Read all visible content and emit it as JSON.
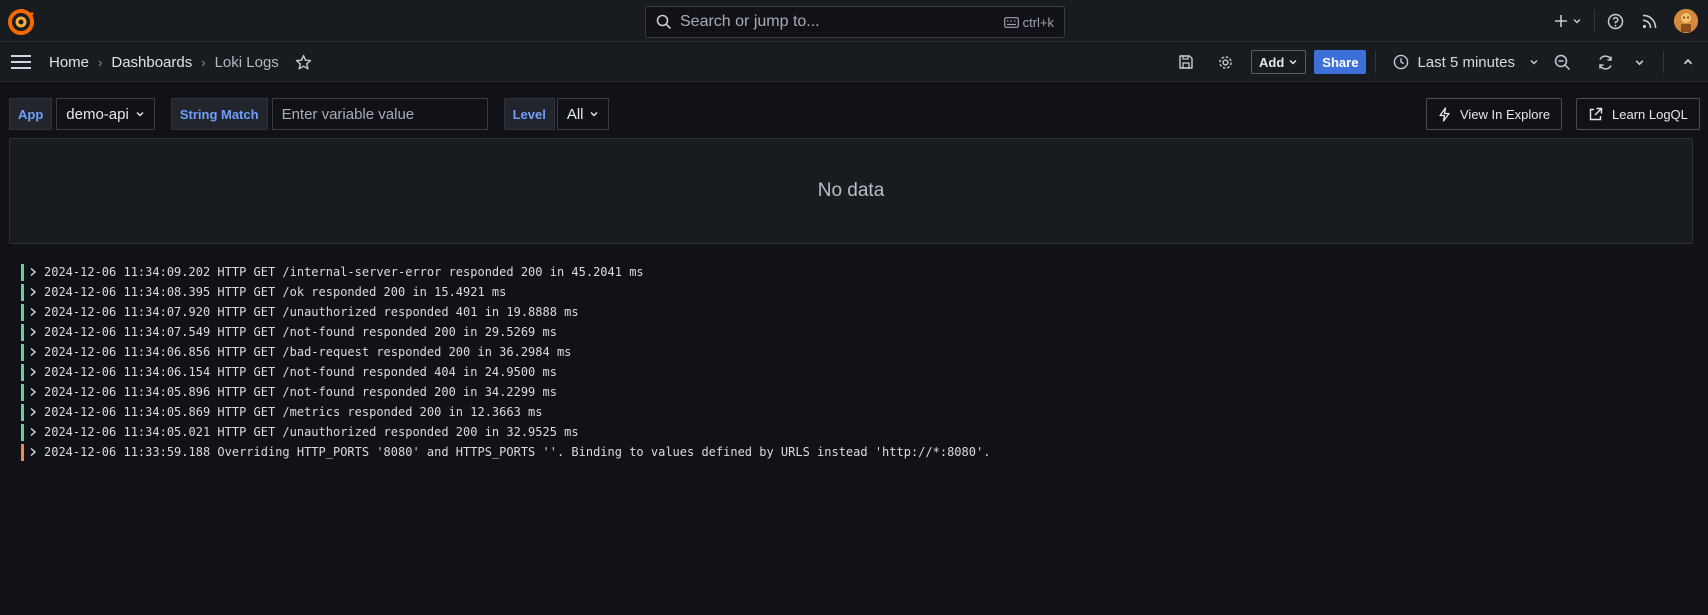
{
  "topbar": {
    "search_placeholder": "Search or jump to...",
    "search_shortcut": "ctrl+k"
  },
  "breadcrumb": [
    {
      "label": "Home"
    },
    {
      "label": "Dashboards"
    },
    {
      "label": "Loki Logs"
    }
  ],
  "toolbar": {
    "add_label": "Add",
    "share_label": "Share",
    "time_range": "Last 5 minutes"
  },
  "variables": {
    "app_label": "App",
    "app_value": "demo-api",
    "string_match_label": "String Match",
    "string_match_placeholder": "Enter variable value",
    "level_label": "Level",
    "level_value": "All"
  },
  "actions": {
    "view_in_explore": "View In Explore",
    "learn_logql": "Learn LogQL"
  },
  "panel": {
    "no_data": "No data"
  },
  "logs": [
    {
      "level": "info",
      "text": "2024-12-06 11:34:09.202 HTTP GET /internal-server-error responded 200 in 45.2041 ms"
    },
    {
      "level": "info",
      "text": "2024-12-06 11:34:08.395 HTTP GET /ok responded 200 in 15.4921 ms"
    },
    {
      "level": "info",
      "text": "2024-12-06 11:34:07.920 HTTP GET /unauthorized responded 401 in 19.8888 ms"
    },
    {
      "level": "info",
      "text": "2024-12-06 11:34:07.549 HTTP GET /not-found responded 200 in 29.5269 ms"
    },
    {
      "level": "info",
      "text": "2024-12-06 11:34:06.856 HTTP GET /bad-request responded 200 in 36.2984 ms"
    },
    {
      "level": "info",
      "text": "2024-12-06 11:34:06.154 HTTP GET /not-found responded 404 in 24.9500 ms"
    },
    {
      "level": "info",
      "text": "2024-12-06 11:34:05.896 HTTP GET /not-found responded 200 in 34.2299 ms"
    },
    {
      "level": "info",
      "text": "2024-12-06 11:34:05.869 HTTP GET /metrics responded 200 in 12.3663 ms"
    },
    {
      "level": "info",
      "text": "2024-12-06 11:34:05.021 HTTP GET /unauthorized responded 200 in 32.9525 ms"
    },
    {
      "level": "warn",
      "text": "2024-12-06 11:33:59.188 Overriding HTTP_PORTS '8080' and HTTPS_PORTS ''. Binding to values defined by URLS instead 'http://*:8080'."
    }
  ],
  "colors": {
    "accent": "#3d71d9",
    "log_info": "#6ccf8e",
    "log_warn": "#f5874a",
    "variable_label": "#6e9fff"
  }
}
